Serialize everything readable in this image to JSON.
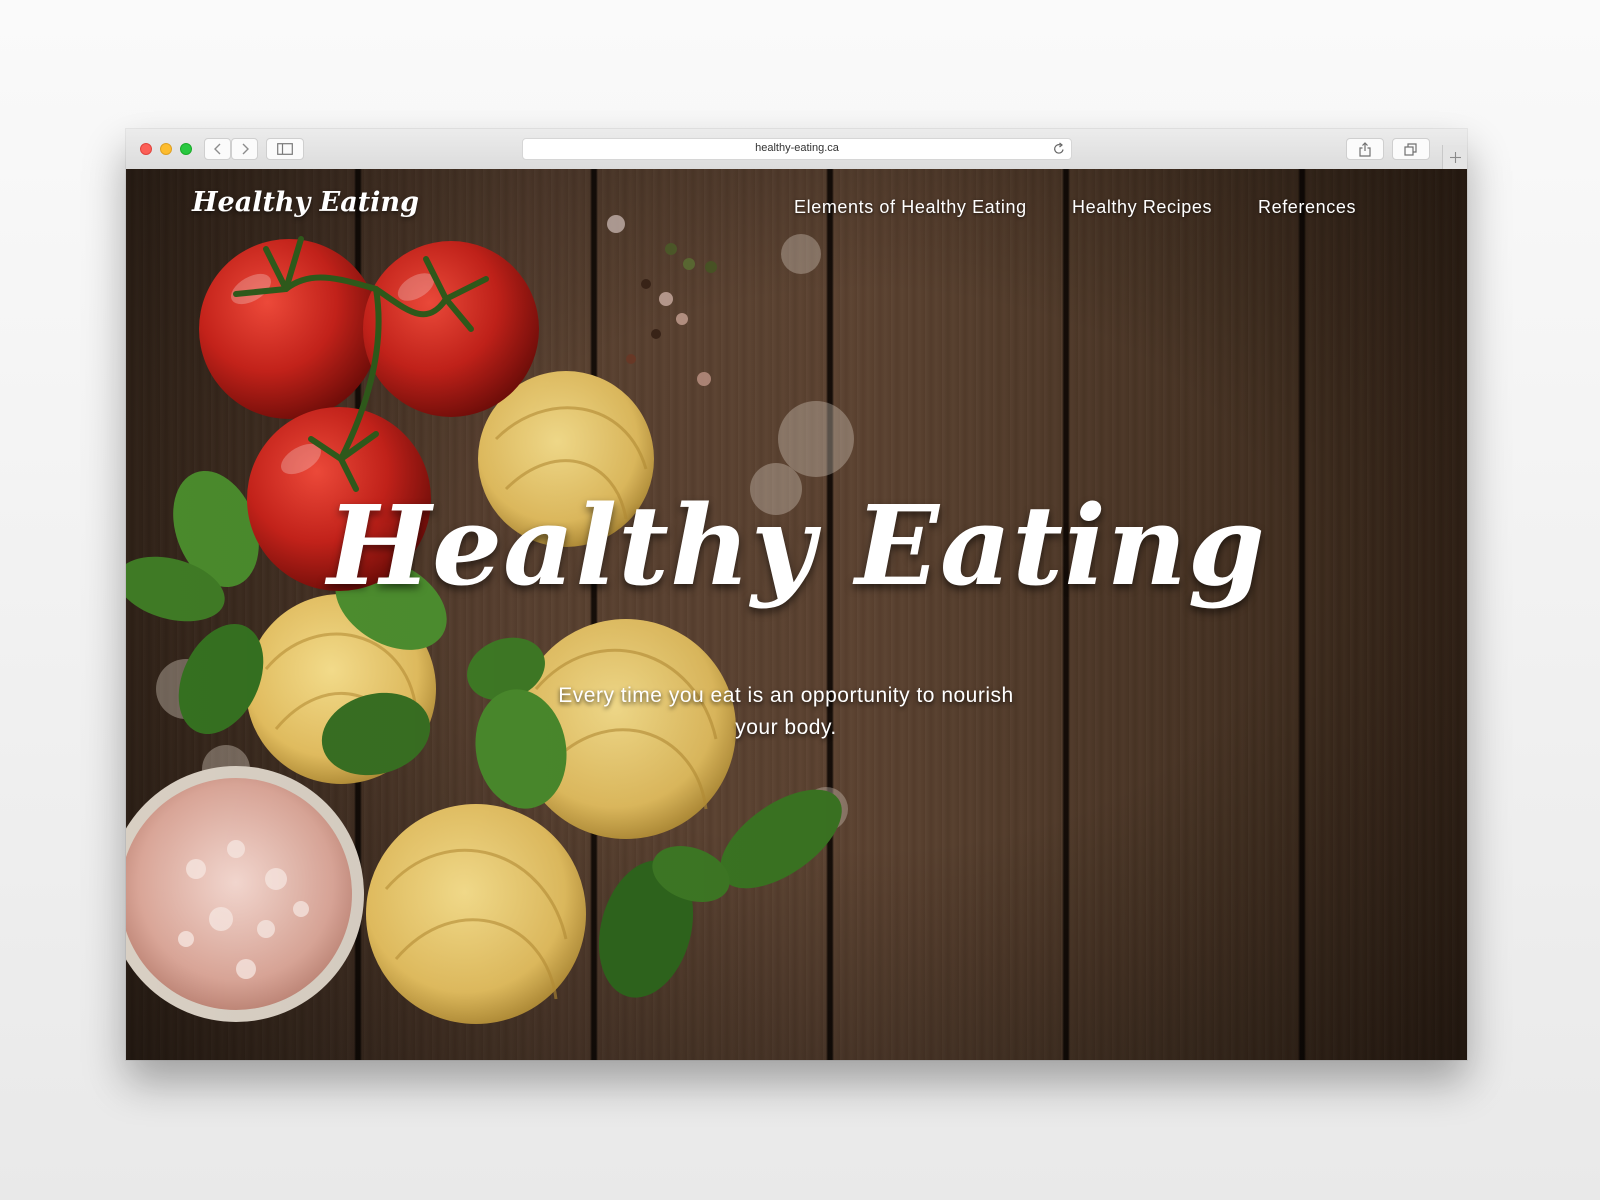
{
  "browser": {
    "url": "healthy-eating.ca"
  },
  "site": {
    "brand": "Healthy Eating",
    "nav": [
      {
        "label": "Elements of Healthy Eating"
      },
      {
        "label": "Healthy Recipes"
      },
      {
        "label": "References"
      }
    ],
    "hero": {
      "title": "Healthy Eating",
      "subtitle": "Every time you eat is an opportunity to nourish your body."
    }
  },
  "colors": {
    "wood": "#5a4130",
    "tomato": "#c4221a",
    "basil": "#3f7a25",
    "pasta": "#e6c466",
    "text": "#ffffff"
  },
  "icons": [
    "back-arrow-icon",
    "forward-arrow-icon",
    "sidebar-icon",
    "reload-icon",
    "share-icon",
    "tabs-icon",
    "plus-icon"
  ]
}
